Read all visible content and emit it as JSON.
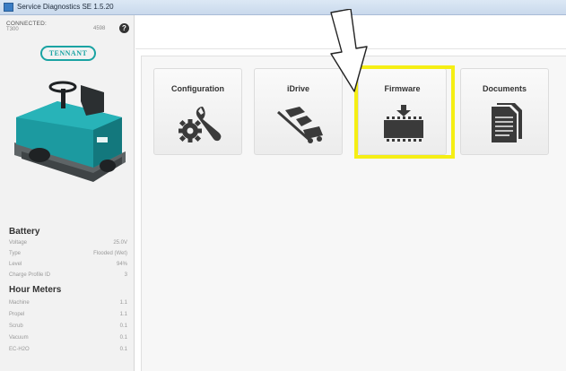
{
  "window": {
    "title": "Service Diagnostics SE 1.5.20"
  },
  "connection": {
    "status": "CONNECTED:",
    "model": "T300",
    "serial": "4598"
  },
  "brand": {
    "logo_text": "TENNANT",
    "accent": "#1aa3a3"
  },
  "battery": {
    "title": "Battery",
    "rows": [
      {
        "label": "Voltage",
        "value": "25.0V"
      },
      {
        "label": "Type",
        "value": "Flooded (Wet)"
      },
      {
        "label": "Level",
        "value": "94%"
      },
      {
        "label": "Charge Profile ID",
        "value": "3"
      }
    ]
  },
  "hour_meters": {
    "title": "Hour Meters",
    "rows": [
      {
        "label": "Machine",
        "value": "1.1"
      },
      {
        "label": "Propel",
        "value": "1.1"
      },
      {
        "label": "Scrub",
        "value": "0.1"
      },
      {
        "label": "Vacuum",
        "value": "0.1"
      },
      {
        "label": "EC-H2O",
        "value": "0.1"
      }
    ]
  },
  "tiles": [
    {
      "label": "Configuration",
      "icon": "wrench-gear-icon"
    },
    {
      "label": "iDrive",
      "icon": "idrive-icon"
    },
    {
      "label": "Firmware",
      "icon": "firmware-chip-icon"
    },
    {
      "label": "Documents",
      "icon": "documents-icon"
    }
  ],
  "highlight_color": "#f5ee14"
}
